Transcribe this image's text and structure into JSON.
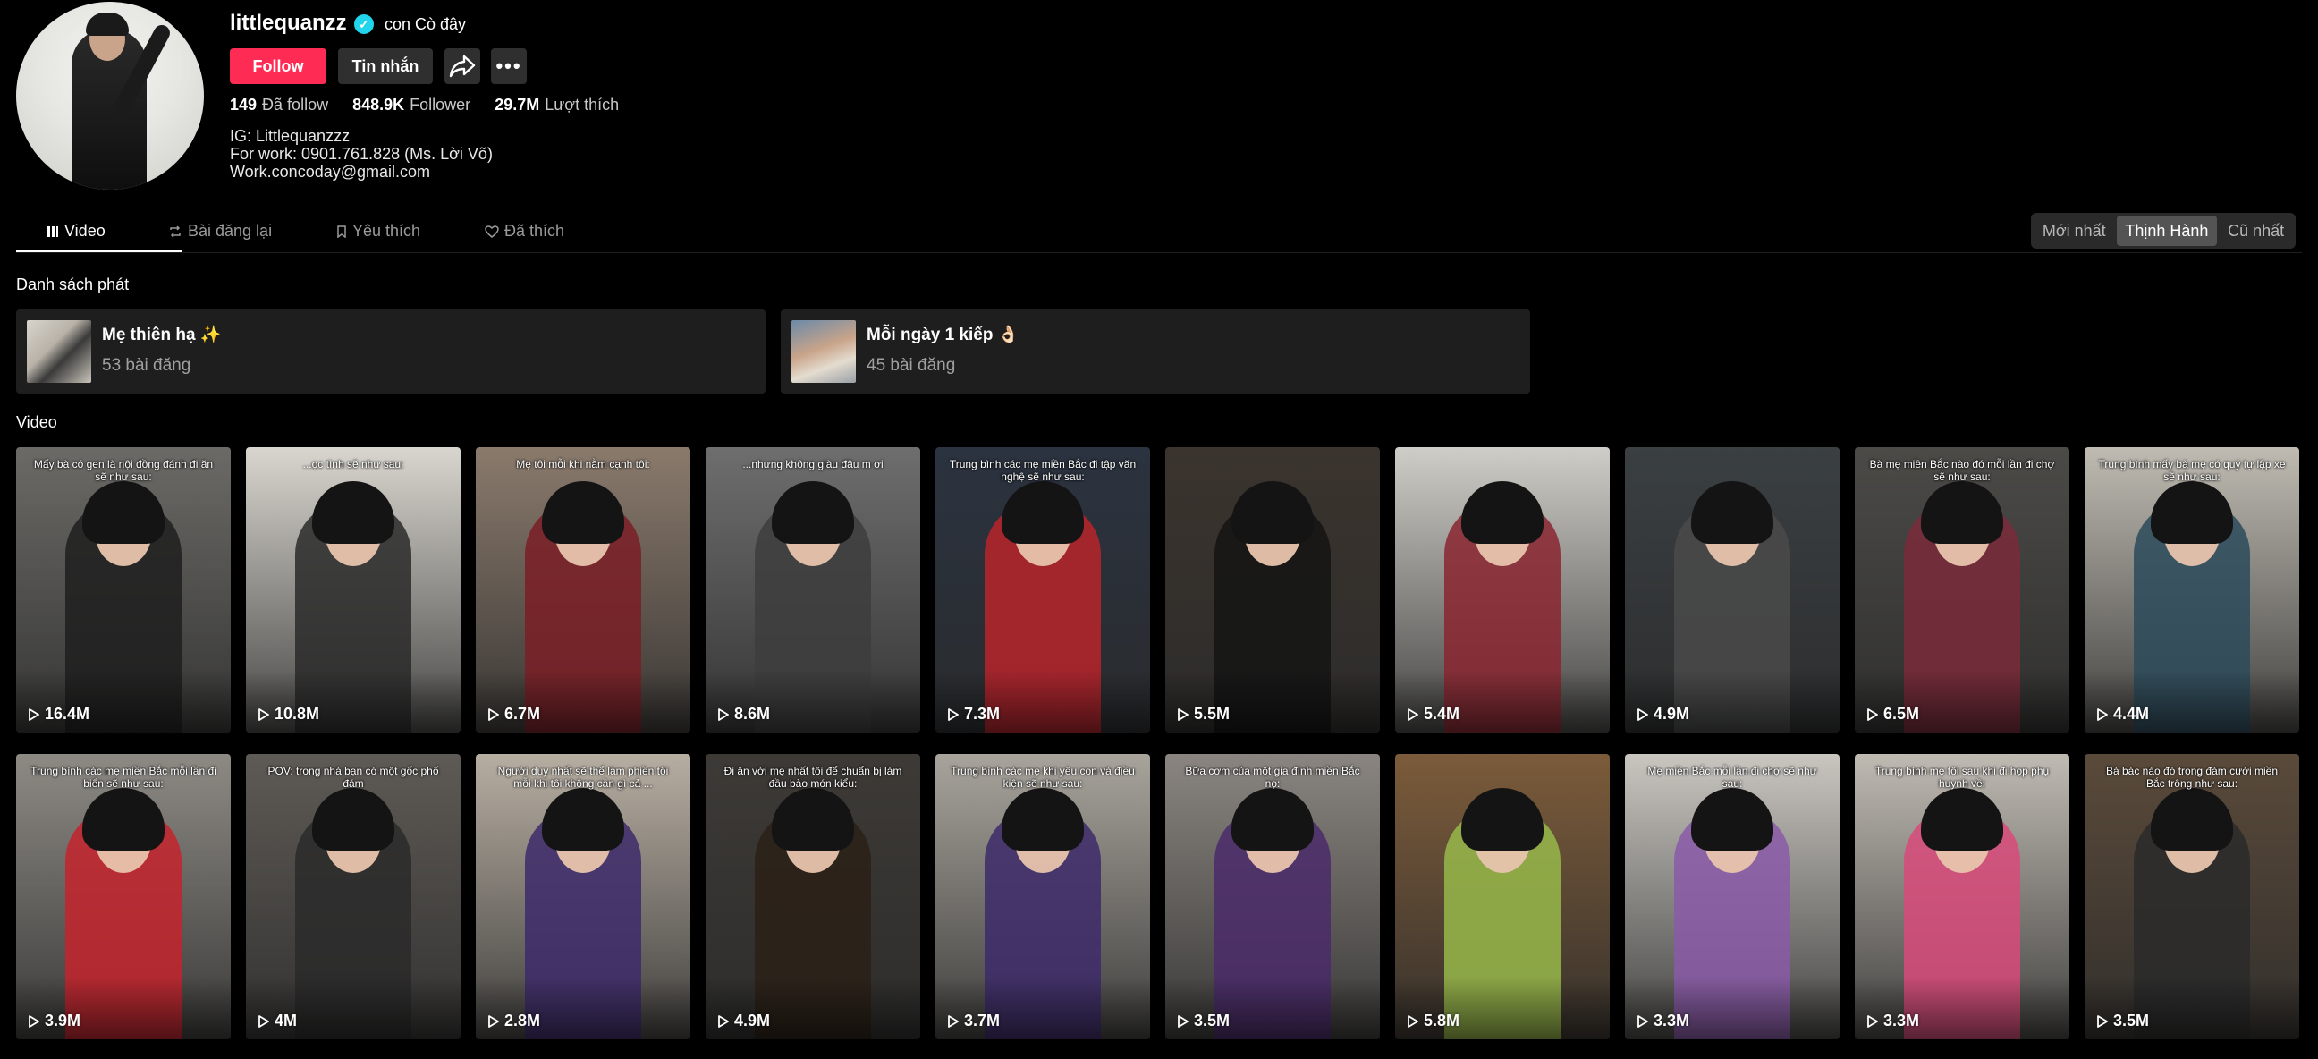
{
  "profile": {
    "username": "littlequanzz",
    "nickname": "con Cò đây",
    "follow_label": "Follow",
    "message_label": "Tin nhắn",
    "stats": [
      {
        "value": "149",
        "label": "Đã follow"
      },
      {
        "value": "848.9K",
        "label": "Follower"
      },
      {
        "value": "29.7M",
        "label": "Lượt thích"
      }
    ],
    "bio": [
      "IG: Littlequanzzz",
      "For work: 0901.761.828 (Ms. Lời Võ)",
      "Work.concoday@gmail.com"
    ]
  },
  "tabs": [
    {
      "label": "Video",
      "icon": "grid-icon",
      "active": true
    },
    {
      "label": "Bài đăng lại",
      "icon": "repost-icon",
      "active": false
    },
    {
      "label": "Yêu thích",
      "icon": "bookmark-icon",
      "active": false
    },
    {
      "label": "Đã thích",
      "icon": "heart-outline-icon",
      "active": false
    }
  ],
  "sort": [
    {
      "label": "Mới nhất",
      "active": false
    },
    {
      "label": "Thịnh Hành",
      "active": true
    },
    {
      "label": "Cũ nhất",
      "active": false
    }
  ],
  "playlists_title": "Danh sách phát",
  "playlists": [
    {
      "name": "Mẹ thiên hạ ✨",
      "count": "53 bài đăng"
    },
    {
      "name": "Mỗi ngày 1 kiếp 👌🏻",
      "count": "45 bài đăng"
    }
  ],
  "videos_title": "Video",
  "videos": [
    {
      "views": "16.4M",
      "caption": "Mấy bà có gen là nội đồng đánh đi ăn sẽ như sau:",
      "bg": "#6b6a66",
      "cloth": "#1f1f1f"
    },
    {
      "views": "10.8M",
      "caption": "...ọc tình sẽ như sau:",
      "bg": "#d9d6cf",
      "cloth": "#2a2a2a"
    },
    {
      "views": "6.7M",
      "caption": "Mẹ tôi mỗi khi nằm cạnh tôi:",
      "bg": "#8a7a6c",
      "cloth": "#7a1f26"
    },
    {
      "views": "8.6M",
      "caption": "...nhưng không giàu đâu m ơi",
      "bg": "#6e6e6e",
      "cloth": "#3d3d3d"
    },
    {
      "views": "7.3M",
      "caption": "Trung bình các mẹ miền Bắc đi tập văn nghệ sẽ như sau:",
      "bg": "#2b3340",
      "cloth": "#b8242c"
    },
    {
      "views": "5.5M",
      "caption": "",
      "bg": "#3b342e",
      "cloth": "#141414"
    },
    {
      "views": "5.4M",
      "caption": "",
      "bg": "#cfcdc7",
      "cloth": "#8a2630"
    },
    {
      "views": "4.9M",
      "caption": "",
      "bg": "#3a3f42",
      "cloth": "#4a4a4a"
    },
    {
      "views": "6.5M",
      "caption": "Bà mẹ miền Bắc nào đó mỗi lần đi chợ sẽ như sau:",
      "bg": "#4b4a47",
      "cloth": "#7a2a3a"
    },
    {
      "views": "4.4M",
      "caption": "Trung bình mấy bà mẹ có quý tự lập xe sẽ như sau:",
      "bg": "#bfbbb2",
      "cloth": "#2c4a5a"
    },
    {
      "views": "3.9M",
      "caption": "Trung bình các mẹ miền Bắc mỗi lần đi biển sẽ như sau:",
      "bg": "#8d8a84",
      "cloth": "#c4232d"
    },
    {
      "views": "4M",
      "caption": "POV: trong nhà bạn có một gốc phố đám",
      "bg": "#5e5a55",
      "cloth": "#2a2a2a"
    },
    {
      "views": "2.8M",
      "caption": "Người duy nhất sẽ thể làm phiền tôi mỗi khi tôi không cần gì cả ...",
      "bg": "#b7aea2",
      "cloth": "#3d2a6a"
    },
    {
      "views": "4.9M",
      "caption": "Đi ăn với mẹ nhất tôi để chuẩn bị làm đầu bảo món kiểu:",
      "bg": "#3d3a36",
      "cloth": "#2a2016"
    },
    {
      "views": "3.7M",
      "caption": "Trung bình các mẹ khi yêu con và điều kiện sẽ như sau:",
      "bg": "#a8a49c",
      "cloth": "#3d2a6a"
    },
    {
      "views": "3.5M",
      "caption": "Bữa cơm của một gia đình miền Bắc nọ:",
      "bg": "#8a8580",
      "cloth": "#4a2a6a"
    },
    {
      "views": "5.8M",
      "caption": "",
      "bg": "#7b5b3a",
      "cloth": "#98b84a"
    },
    {
      "views": "3.3M",
      "caption": "Mẹ miền Bắc mỗi lần đi chợ sẽ như sau:",
      "bg": "#c9c6c0",
      "cloth": "#8a5aa8"
    },
    {
      "views": "3.3M",
      "caption": "Trung bình mẹ tôi sau khi đi họp phụ huynh về:",
      "bg": "#bfbab2",
      "cloth": "#d84a7a"
    },
    {
      "views": "3.5M",
      "caption": "Bà bác nào đó trong đám cưới miền Bắc trông như sau:",
      "bg": "#5a4a3a",
      "cloth": "#2a2a2a"
    }
  ]
}
